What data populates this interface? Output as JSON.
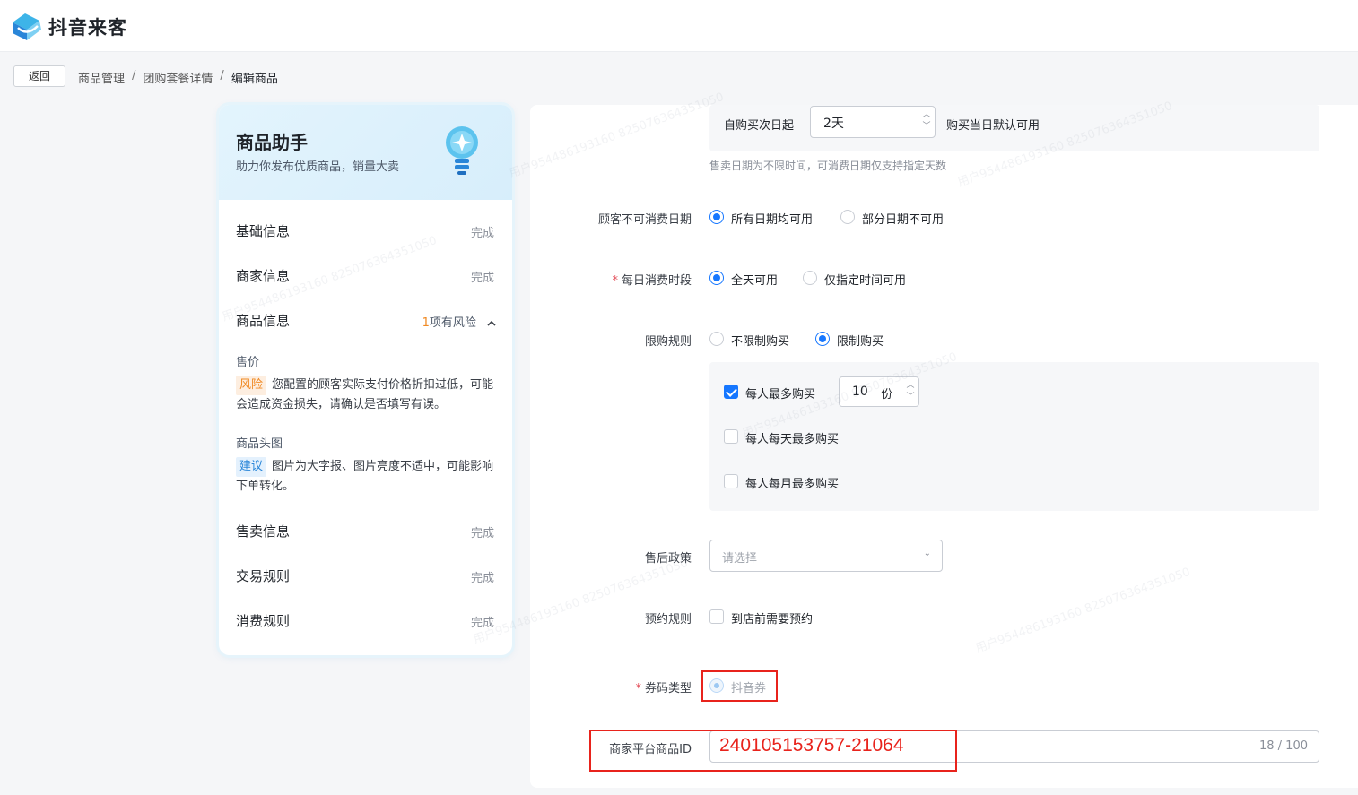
{
  "header": {
    "brand": "抖音来客"
  },
  "nav": {
    "back_label": "返回",
    "breadcrumb": [
      "商品管理",
      "团购套餐详情",
      "编辑商品"
    ],
    "separator": "/"
  },
  "assistant": {
    "title": "商品助手",
    "subtitle": "助力你发布优质商品，销量大卖",
    "sections": [
      {
        "label": "基础信息",
        "status": "完成"
      },
      {
        "label": "商家信息",
        "status": "完成"
      },
      {
        "label": "商品信息",
        "risk_count": "1",
        "risk_text": "项有风险",
        "expanded_icon": "chevron-up-icon"
      },
      {
        "label": "售卖信息",
        "status": "完成"
      },
      {
        "label": "交易规则",
        "status": "完成"
      },
      {
        "label": "消费规则",
        "status": "完成"
      }
    ],
    "tips": [
      {
        "field": "售价",
        "tag": "风险",
        "text": "您配置的顾客实际支付价格折扣过低，可能会造成资金损失，请确认是否填写有误。"
      },
      {
        "field": "商品头图",
        "tag": "建议",
        "text": "图片为大字报、图片亮度不适中，可能影响下单转化。"
      }
    ]
  },
  "form": {
    "validity": {
      "prefix": "自购买次日起",
      "value": "2天",
      "suffix": "购买当日默认可用",
      "hint": "售卖日期为不限时间，可消费日期仅支持指定天数"
    },
    "unavailable_dates": {
      "label": "顾客不可消费日期",
      "options": [
        "所有日期均可用",
        "部分日期不可用"
      ],
      "selected": "所有日期均可用"
    },
    "daily_period": {
      "required": "*",
      "label": "每日消费时段",
      "options": [
        "全天可用",
        "仅指定时间可用"
      ],
      "selected": "全天可用"
    },
    "purchase_limit": {
      "label": "限购规则",
      "options": [
        "不限制购买",
        "限制购买"
      ],
      "selected": "限制购买",
      "limits": [
        {
          "label": "每人最多购买",
          "checked": true,
          "value": "10",
          "unit": "份"
        },
        {
          "label": "每人每天最多购买",
          "checked": false
        },
        {
          "label": "每人每月最多购买",
          "checked": false
        }
      ]
    },
    "after_sale": {
      "label": "售后政策",
      "placeholder": "请选择"
    },
    "reservation": {
      "label": "预约规则",
      "option": "到店前需要预约",
      "checked": false
    },
    "voucher_type": {
      "required": "*",
      "label": "券码类型",
      "option": "抖音券"
    },
    "merchant_id": {
      "label": "商家平台商品ID",
      "value": "240105153757-21064",
      "count": "18 / 100"
    }
  },
  "watermark": "用户9544861931​60 825076364351050",
  "colors": {
    "primary": "#1677ff",
    "highlight": "#e8231c",
    "risk": "#f08a24",
    "suggest": "#2a86d8"
  }
}
